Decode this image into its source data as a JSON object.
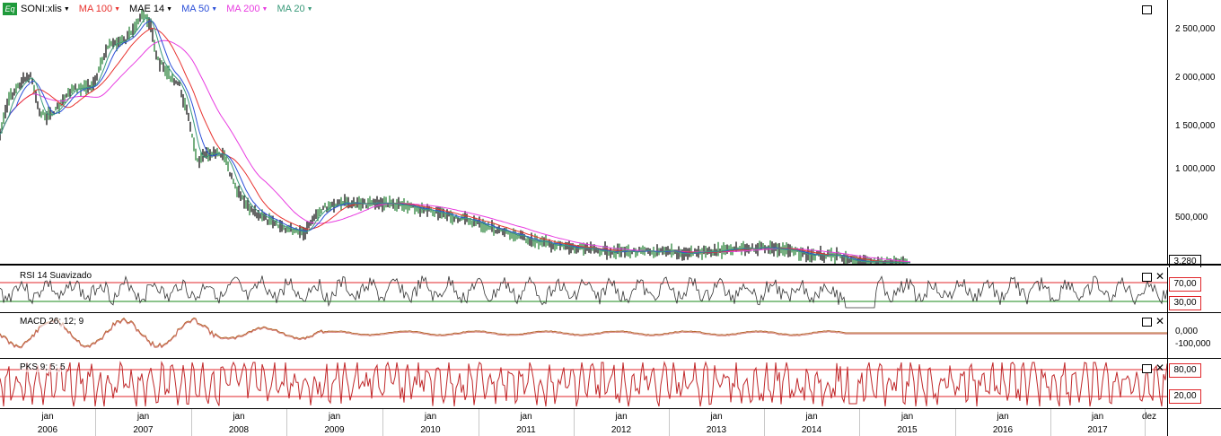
{
  "legend": {
    "badge": "Eq",
    "symbol": "SONI:xlis",
    "items": [
      {
        "label": "MA 100",
        "color": "#e8322e"
      },
      {
        "label": "MAE 14",
        "color": "#000000"
      },
      {
        "label": "MA 50",
        "color": "#2b4fd8"
      },
      {
        "label": "MA 200",
        "color": "#e83ce0"
      },
      {
        "label": "MA 20",
        "color": "#3a9a7a"
      }
    ]
  },
  "price_axis": {
    "labels": [
      "2 500,000",
      "2 000,000",
      "1 500,000",
      "1 000,000",
      "500,000"
    ],
    "last_price": "3,280"
  },
  "rsi": {
    "title": "RSI 14 Suavizado",
    "levels": [
      "70,00",
      "30,00"
    ]
  },
  "macd": {
    "title": "MACD 26; 12; 9",
    "labels": [
      "0,000",
      "-100,000"
    ]
  },
  "pks": {
    "title": "PKS 9; 5; 5",
    "levels": [
      "80,00",
      "20,00"
    ]
  },
  "timebar": {
    "months": [
      "jan",
      "jan",
      "jan",
      "jan",
      "jan",
      "jan",
      "jan",
      "jan",
      "jan",
      "jan",
      "jan",
      "jan",
      "dez"
    ],
    "years": [
      "2006",
      "2007",
      "2008",
      "2009",
      "2010",
      "2011",
      "2012",
      "2013",
      "2014",
      "2015",
      "2016",
      "2017"
    ]
  },
  "colors": {
    "ma100": "#e8322e",
    "ma50": "#2b4fd8",
    "ma200": "#e83ce0",
    "ma20": "#3a9a7a",
    "rsi_upper": "#e0262a",
    "rsi_lower": "#1a8a1a",
    "macd_line": "#b5642a",
    "pks_line": "#c0282a"
  }
}
